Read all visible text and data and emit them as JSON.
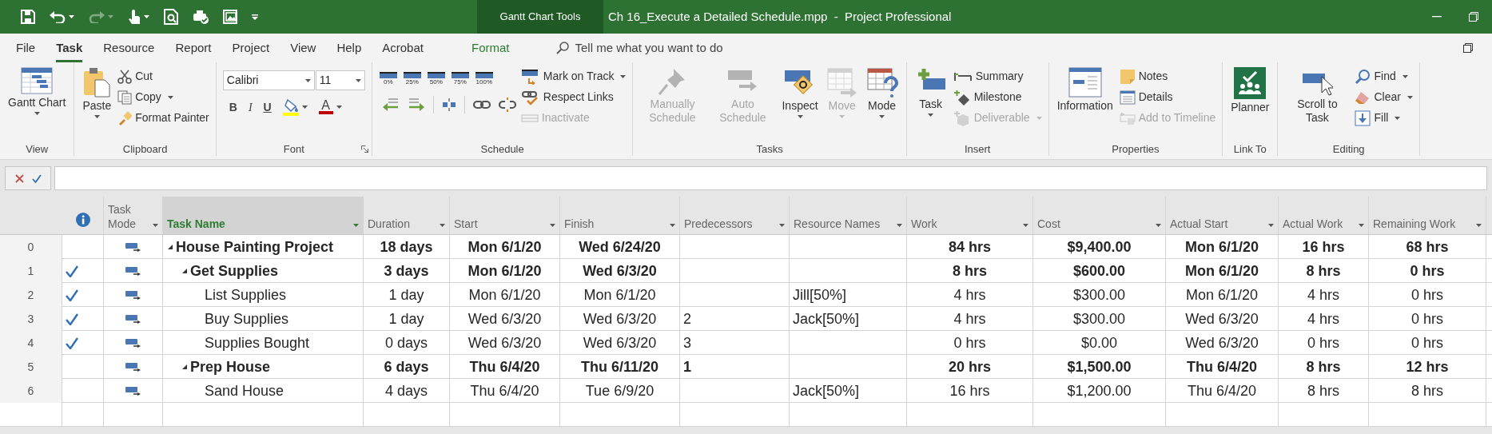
{
  "title_bar": {
    "context_tab": "Gantt Chart Tools",
    "title": "Ch 16_Execute a Detailed Schedule.mpp  -  Project Professional"
  },
  "tabs": [
    {
      "label": "File",
      "kind": "file",
      "selected": false
    },
    {
      "label": "Task",
      "kind": "normal",
      "selected": true
    },
    {
      "label": "Resource",
      "kind": "normal",
      "selected": false
    },
    {
      "label": "Report",
      "kind": "normal",
      "selected": false
    },
    {
      "label": "Project",
      "kind": "normal",
      "selected": false
    },
    {
      "label": "View",
      "kind": "normal",
      "selected": false
    },
    {
      "label": "Help",
      "kind": "normal",
      "selected": false
    },
    {
      "label": "Acrobat",
      "kind": "normal",
      "selected": false
    },
    {
      "label": "Format",
      "kind": "contextual",
      "selected": false
    }
  ],
  "search": {
    "placeholder": "Tell me what you want to do"
  },
  "ribbon": {
    "groups": [
      {
        "label": "View",
        "launcher": false,
        "columns": [
          {
            "kind": "large",
            "items": [
              {
                "label": "Gantt Chart",
                "dropdown": true,
                "disabled": false
              }
            ]
          }
        ]
      },
      {
        "label": "Clipboard",
        "launcher": false,
        "columns": [
          {
            "kind": "large",
            "items": [
              {
                "label": "Paste",
                "dropdown": true,
                "disabled": false
              }
            ]
          },
          {
            "kind": "small",
            "items": [
              {
                "label": "Cut",
                "dropdown": false,
                "disabled": false
              },
              {
                "label": "Copy",
                "dropdown": true,
                "disabled": false
              },
              {
                "label": "Format Painter",
                "dropdown": false,
                "disabled": false
              }
            ]
          }
        ]
      },
      {
        "label": "Font",
        "launcher": true,
        "columns": [
          {
            "kind": "font",
            "font_name": "Calibri",
            "font_size": "11",
            "font_color": "A",
            "buttons": [
              {
                "label": "B",
                "kind": "bold"
              },
              {
                "label": "I",
                "kind": "italic"
              },
              {
                "label": "U",
                "kind": "underline"
              }
            ]
          }
        ]
      },
      {
        "label": "Schedule",
        "launcher": false,
        "columns": [
          {
            "kind": "percent",
            "items": [
              {
                "label": "0%"
              },
              {
                "label": "25%"
              },
              {
                "label": "50%"
              },
              {
                "label": "75%"
              },
              {
                "label": "100%"
              }
            ]
          },
          {
            "kind": "small",
            "items": [
              {
                "label": "Mark on Track",
                "dropdown": true,
                "disabled": false
              },
              {
                "label": "Respect Links",
                "dropdown": false,
                "disabled": false
              },
              {
                "label": "Inactivate",
                "dropdown": false,
                "disabled": true
              }
            ]
          }
        ]
      },
      {
        "label": "Tasks",
        "launcher": false,
        "columns": [
          {
            "kind": "large",
            "items": [
              {
                "label": "Manually Schedule",
                "dropdown": false,
                "disabled": true
              },
              {
                "label": "Auto Schedule",
                "dropdown": false,
                "disabled": true
              },
              {
                "label": "Inspect",
                "dropdown": true,
                "disabled": false
              },
              {
                "label": "Move",
                "dropdown": true,
                "disabled": true
              },
              {
                "label": "Mode",
                "dropdown": true,
                "disabled": false
              }
            ]
          }
        ]
      },
      {
        "label": "Insert",
        "launcher": false,
        "columns": [
          {
            "kind": "large",
            "items": [
              {
                "label": "Task",
                "dropdown": true,
                "disabled": false
              }
            ]
          },
          {
            "kind": "small",
            "items": [
              {
                "label": "Summary",
                "dropdown": false,
                "disabled": false
              },
              {
                "label": "Milestone",
                "dropdown": false,
                "disabled": false
              },
              {
                "label": "Deliverable",
                "dropdown": true,
                "disabled": true
              }
            ]
          }
        ]
      },
      {
        "label": "Properties",
        "launcher": false,
        "columns": [
          {
            "kind": "large",
            "items": [
              {
                "label": "Information",
                "dropdown": false,
                "disabled": false
              }
            ]
          },
          {
            "kind": "small",
            "items": [
              {
                "label": "Notes",
                "dropdown": false,
                "disabled": false
              },
              {
                "label": "Details",
                "dropdown": false,
                "disabled": false
              },
              {
                "label": "Add to Timeline",
                "dropdown": false,
                "disabled": true
              }
            ]
          }
        ]
      },
      {
        "label": "Link To",
        "launcher": false,
        "columns": [
          {
            "kind": "large",
            "items": [
              {
                "label": "Planner",
                "dropdown": false,
                "disabled": false
              }
            ]
          }
        ]
      },
      {
        "label": "Editing",
        "launcher": false,
        "columns": [
          {
            "kind": "large",
            "items": [
              {
                "label": "Scroll to Task",
                "dropdown": false,
                "disabled": false
              }
            ]
          },
          {
            "kind": "small",
            "items": [
              {
                "label": "Find",
                "dropdown": true,
                "disabled": false
              },
              {
                "label": "Clear",
                "dropdown": true,
                "disabled": false
              },
              {
                "label": "Fill",
                "dropdown": true,
                "disabled": false
              }
            ]
          }
        ]
      }
    ]
  },
  "table": {
    "columns": [
      {
        "label": "Task Mode",
        "selected": false
      },
      {
        "label": "Task Name",
        "selected": true
      },
      {
        "label": "Duration",
        "selected": false
      },
      {
        "label": "Start",
        "selected": false
      },
      {
        "label": "Finish",
        "selected": false
      },
      {
        "label": "Predecessors",
        "selected": false
      },
      {
        "label": "Resource Names",
        "selected": false
      },
      {
        "label": "Work",
        "selected": false
      },
      {
        "label": "Cost",
        "selected": false
      },
      {
        "label": "Actual Start",
        "selected": false
      },
      {
        "label": "Actual Work",
        "selected": false
      },
      {
        "label": "Remaining Work",
        "selected": false
      }
    ],
    "rows": [
      {
        "id": "0",
        "name": "House Painting Project",
        "done": false,
        "expanded": true,
        "duration": "18 days",
        "start": "Mon 6/1/20",
        "finish": "Wed 6/24/20",
        "work": "84 hrs",
        "cost": "$9,400.00",
        "actual_start": "Mon 6/1/20",
        "actual_work": "16 hrs",
        "remaining_work": "68 hrs",
        "children": [
          {
            "id": "1",
            "name": "Get Supplies",
            "done": true,
            "expanded": true,
            "duration": "3 days",
            "start": "Mon 6/1/20",
            "finish": "Wed 6/3/20",
            "work": "8 hrs",
            "cost": "$600.00",
            "actual_start": "Mon 6/1/20",
            "actual_work": "8 hrs",
            "remaining_work": "0 hrs",
            "children": [
              {
                "id": "2",
                "name": "List Supplies",
                "done": true,
                "duration": "1 day",
                "start": "Mon 6/1/20",
                "finish": "Mon 6/1/20",
                "resource_names": "Jill[50%]",
                "work": "4 hrs",
                "cost": "$300.00",
                "actual_start": "Mon 6/1/20",
                "actual_work": "4 hrs",
                "remaining_work": "0 hrs"
              },
              {
                "id": "3",
                "name": "Buy Supplies",
                "done": true,
                "duration": "1 day",
                "start": "Wed 6/3/20",
                "finish": "Wed 6/3/20",
                "predecessors": "2",
                "resource_names": "Jack[50%]",
                "work": "4 hrs",
                "cost": "$300.00",
                "actual_start": "Wed 6/3/20",
                "actual_work": "4 hrs",
                "remaining_work": "0 hrs"
              },
              {
                "id": "4",
                "name": "Supplies Bought",
                "done": true,
                "duration": "0 days",
                "start": "Wed 6/3/20",
                "finish": "Wed 6/3/20",
                "predecessors": "3",
                "work": "0 hrs",
                "cost": "$0.00",
                "actual_start": "Wed 6/3/20",
                "actual_work": "0 hrs",
                "remaining_work": "0 hrs"
              }
            ]
          },
          {
            "id": "5",
            "name": "Prep House",
            "done": false,
            "expanded": true,
            "duration": "6 days",
            "start": "Thu 6/4/20",
            "finish": "Thu 6/11/20",
            "predecessors": "1",
            "work": "20 hrs",
            "cost": "$1,500.00",
            "actual_start": "Thu 6/4/20",
            "actual_work": "8 hrs",
            "remaining_work": "12 hrs",
            "children": [
              {
                "id": "6",
                "name": "Sand House",
                "done": false,
                "duration": "4 days",
                "start": "Thu 6/4/20",
                "finish": "Tue 6/9/20",
                "resource_names": "Jack[50%]",
                "work": "16 hrs",
                "cost": "$1,200.00",
                "actual_start": "Thu 6/4/20",
                "actual_work": "8 hrs",
                "remaining_work": "8 hrs"
              }
            ]
          }
        ]
      }
    ]
  }
}
